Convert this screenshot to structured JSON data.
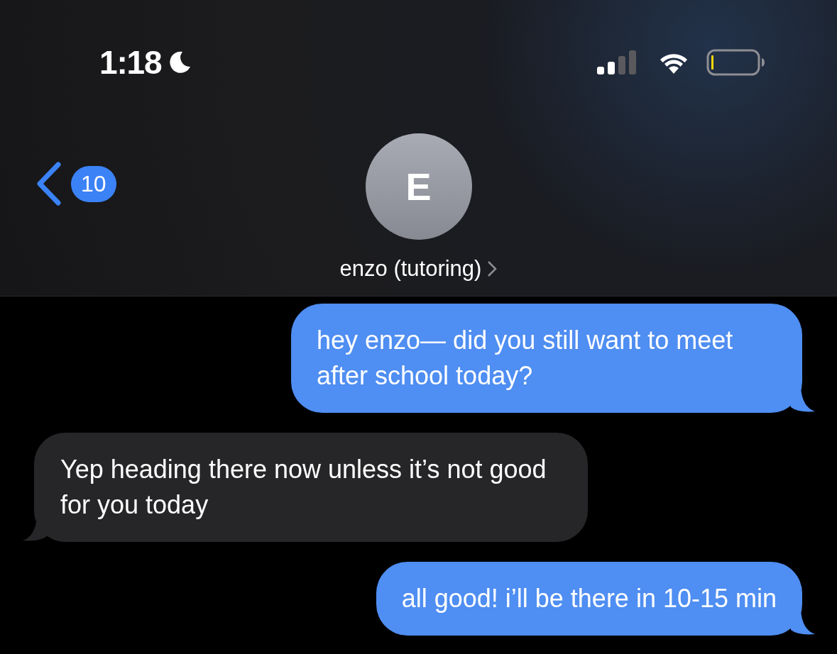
{
  "status_bar": {
    "time": "1:18"
  },
  "header": {
    "back_badge": "10",
    "avatar_initial": "E",
    "contact_name": "enzo (tutoring)"
  },
  "messages": [
    {
      "kind": "sent",
      "text": "hey enzo— did you still want to meet after school today?"
    },
    {
      "kind": "received",
      "text": "Yep heading there now unless it’s not good for you today"
    },
    {
      "kind": "sent",
      "text": "all good! i’ll be there in 10-15 min"
    }
  ]
}
